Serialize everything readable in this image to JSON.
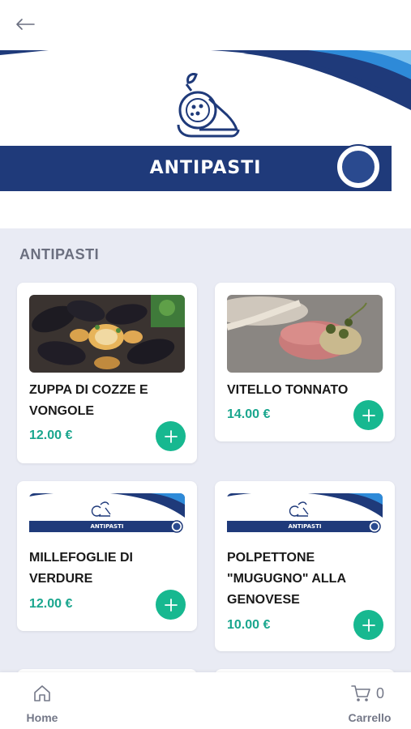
{
  "header": {
    "back_icon": "arrow-left-icon"
  },
  "banner": {
    "title": "ANTIPASTI",
    "colors": {
      "navy": "#1f3a7a",
      "sky": "#2e8ad8"
    }
  },
  "section": {
    "title": "ANTIPASTI"
  },
  "products": [
    {
      "name": "ZUPPA DI COZZE E VONGOLE",
      "price": "12.00 €",
      "image": "mussels-and-clams-photo"
    },
    {
      "name": "VITELLO TONNATO",
      "price": "14.00 €",
      "image": "vitello-tonnato-photo"
    },
    {
      "name": "MILLEFOGLIE DI VERDURE",
      "price": "12.00 €",
      "image": "antipasti-banner-placeholder",
      "image_label": "ANTIPASTI"
    },
    {
      "name": "POLPETTONE \"MUGUGNO\" ALLA GENOVESE",
      "price": "10.00 €",
      "image": "antipasti-banner-placeholder",
      "image_label": "ANTIPASTI"
    }
  ],
  "bottom_nav": {
    "home_label": "Home",
    "cart_label": "Carrello",
    "cart_count": "0"
  },
  "colors": {
    "accent": "#17b890",
    "price": "#1aa68e",
    "background": "#e9ebf4"
  }
}
